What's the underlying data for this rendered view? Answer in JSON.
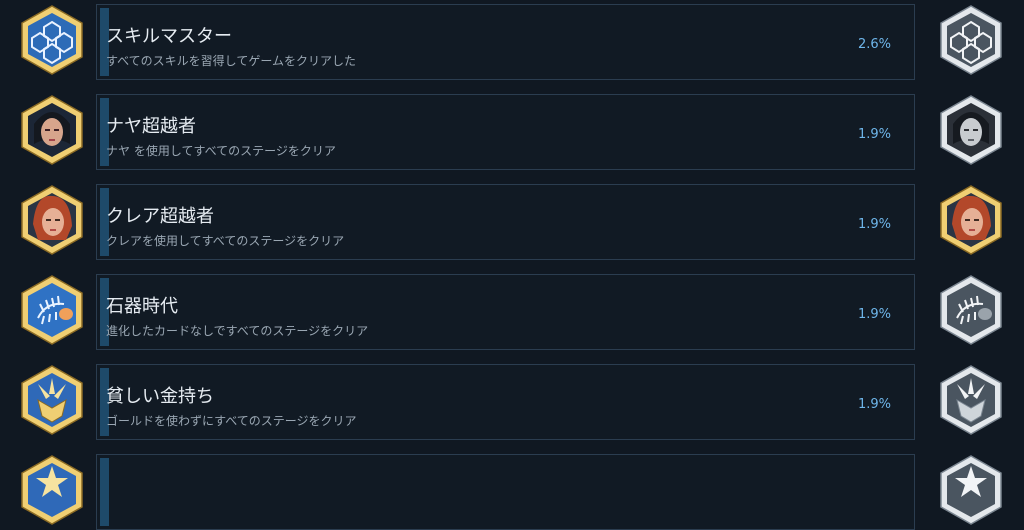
{
  "achievements": [
    {
      "title": "スキルマスター",
      "description": "すべてのスキルを習得してゲームをクリアした",
      "percent_text": "2.6%",
      "percent": 2.6,
      "icon": "hexagon-pattern-icon"
    },
    {
      "title": "ナヤ超越者",
      "description": "ナヤ を使用してすべてのステージをクリア",
      "percent_text": "1.9%",
      "percent": 1.9,
      "icon": "naya-portrait-icon"
    },
    {
      "title": "クレア超越者",
      "description": "クレアを使用してすべてのステージをクリア",
      "percent_text": "1.9%",
      "percent": 1.9,
      "icon": "claire-portrait-icon"
    },
    {
      "title": "石器時代",
      "description": "進化したカードなしですべてのステージをクリア",
      "percent_text": "1.9%",
      "percent": 1.9,
      "icon": "fish-skeleton-icon"
    },
    {
      "title": "貧しい金持ち",
      "description": "ゴールドを使わずにすべてのステージをクリア",
      "percent_text": "1.9%",
      "percent": 1.9,
      "icon": "crest-burst-icon"
    },
    {
      "title": "",
      "description": "",
      "percent_text": "",
      "percent": null,
      "icon": "star-burst-icon"
    }
  ],
  "colors": {
    "page_bg": "#101822",
    "card_border": "#2b3d50",
    "progress_fill": "#1e4a6a",
    "percent_text": "#6fb6ea",
    "gold_badge": "#f2d27a",
    "blue_badge": "#2f69b8",
    "silver_badge": "#d7dde2"
  }
}
